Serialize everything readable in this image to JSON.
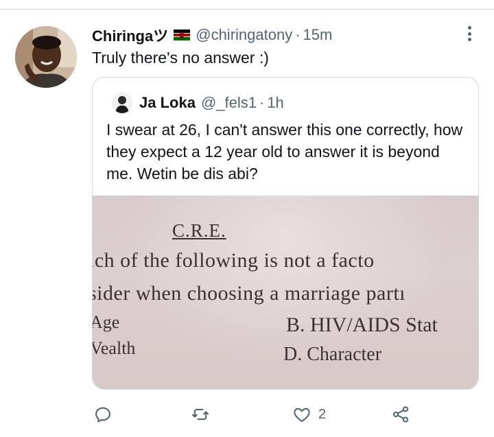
{
  "tweet": {
    "author_name": "Chiringaツ",
    "flag_icon": "kenya-flag-icon",
    "handle": "@chiringatony",
    "separator": "·",
    "time": "15m",
    "text": "Truly there's no answer :)"
  },
  "quote": {
    "author_name": "Ja Loka",
    "handle": "@_fels1",
    "separator": "·",
    "time": "1h",
    "text": "I swear at 26, I can't answer this one correctly, how they expect a 12 year old to answer it is beyond me. Wetin be dis abi?",
    "photo_text": {
      "title": "C.R.E.",
      "line1": "ich of the following is not a facto",
      "line2": "sider when choosing a marriage partı",
      "option_a": "Age",
      "option_b": "B. HIV/AIDS Stat",
      "option_c": "Vealth",
      "option_d": "D. Character"
    }
  },
  "actions": {
    "reply_icon": "reply-icon",
    "retweet_icon": "retweet-icon",
    "like_icon": "heart-icon",
    "like_count": "2",
    "share_icon": "share-icon"
  },
  "colors": {
    "text_primary": "#0f1419",
    "text_secondary": "#536471",
    "border": "#cfd9de",
    "icon": "#536471"
  }
}
